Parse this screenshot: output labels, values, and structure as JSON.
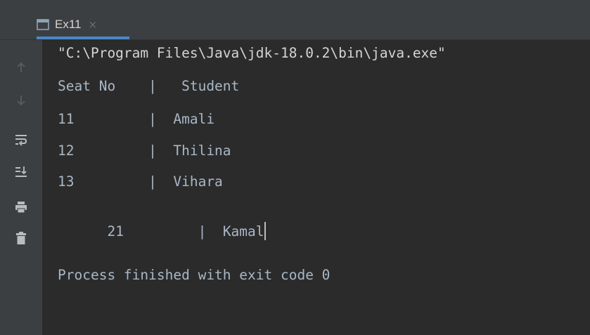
{
  "tab": {
    "label": "Ex11",
    "close": "×",
    "icon": "console-window-icon"
  },
  "toolbar": {
    "icons": [
      "arrow-up-icon",
      "arrow-down-icon",
      "soft-wrap-icon",
      "scroll-to-end-icon",
      "print-icon",
      "trash-icon"
    ]
  },
  "console": {
    "command": "\"C:\\Program Files\\Java\\jdk-18.0.2\\bin\\java.exe\"",
    "header": "Seat No    |   Student",
    "rows": [
      "11         |  Amali",
      "12         |  Thilina",
      "13         |  Vihara",
      "21         |  Kamal"
    ],
    "footer": "Process finished with exit code 0"
  },
  "colors": {
    "background": "#2b2b2b",
    "panel": "#3c3f41",
    "text": "#a9b7c6",
    "accent": "#4a88c7"
  }
}
